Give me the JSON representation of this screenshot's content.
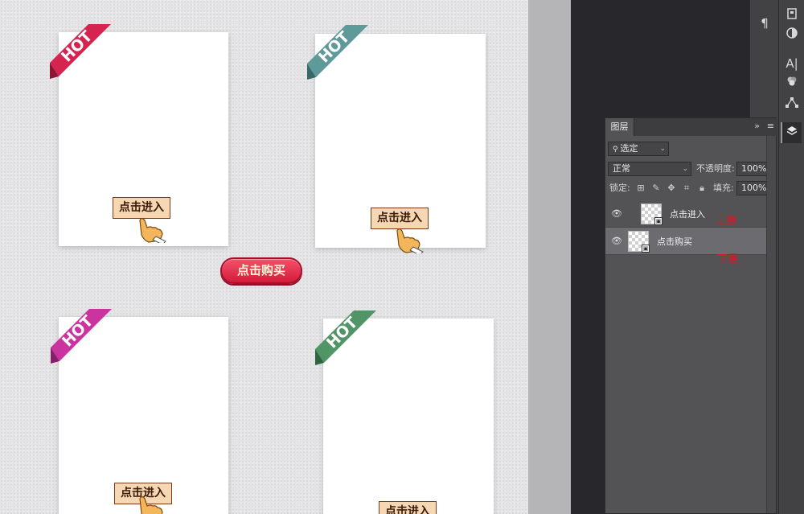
{
  "canvas": {
    "cards": [
      {
        "ribbon_text": "HOT",
        "ribbon_color": "#d4244f",
        "ribbon_dark": "#8e1433",
        "button_label": "点击进入"
      },
      {
        "ribbon_text": "HOT",
        "ribbon_color": "#5f9a9a",
        "ribbon_dark": "#3a6868",
        "button_label": "点击进入"
      },
      {
        "ribbon_text": "HOT",
        "ribbon_color": "#c9349e",
        "ribbon_dark": "#86206a",
        "button_label": "点击进入"
      },
      {
        "ribbon_text": "HOT",
        "ribbon_color": "#4f9566",
        "ribbon_dark": "#2f6442",
        "button_label": "点击进入"
      }
    ],
    "buy_button_label": "点击购买"
  },
  "toolbar": {
    "icons": [
      "library-icon",
      "adjustments-icon",
      "paragraph-icon",
      "character-icon",
      "styles-icon",
      "paths-icon",
      "layers-icon"
    ],
    "paragraph_glyph": "¶",
    "character_glyph": "A|"
  },
  "layers_panel": {
    "tab_title": "图层",
    "collapse_glyph": "»",
    "filter_kind": "选定",
    "blend_mode": "正常",
    "opacity_label": "不透明度:",
    "opacity_value": "100%",
    "lock_label": "锁定:",
    "fill_label": "填充:",
    "fill_value": "100%",
    "layers": [
      {
        "name": "点击进入",
        "selected": false,
        "annotation": "上层"
      },
      {
        "name": "点击购买",
        "selected": true,
        "annotation": "下层"
      }
    ]
  }
}
